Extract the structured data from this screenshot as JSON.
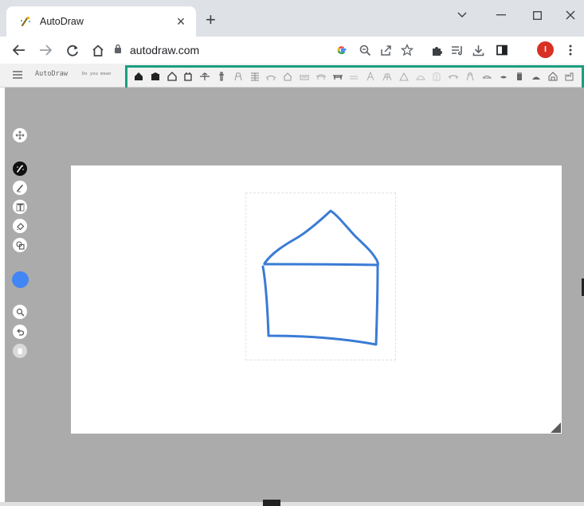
{
  "browser": {
    "tab_title": "AutoDraw",
    "new_tab_icon": "plus-icon",
    "url": "autodraw.com",
    "profile_initial": "I",
    "profile_color": "#d93025",
    "toolbar_icons": [
      "google-icon",
      "zoom-icon",
      "share-icon",
      "bookmark-star-icon",
      "extensions-icon",
      "reading-list-icon",
      "download-icon",
      "side-panel-icon"
    ]
  },
  "app": {
    "brand": "AutoDraw",
    "suggestion_prompt": "Do you mean",
    "suggestions_highlight_color": "#1a9e7f",
    "suggestions": [
      "house",
      "barn",
      "house",
      "church",
      "castle",
      "tent",
      "tower",
      "lighthouse",
      "mailbox",
      "building",
      "shop",
      "apartment",
      "bus-stop",
      "fence",
      "playground",
      "slide",
      "pyramid",
      "igloo",
      "windmill",
      "bridge",
      "gazebo",
      "greenhouse",
      "cottage",
      "hut",
      "school",
      "temple",
      "factory"
    ],
    "tools": [
      "move-icon",
      "autodraw-icon",
      "draw-icon",
      "type-icon",
      "fill-icon",
      "shape-icon",
      "zoom-icon",
      "undo-icon",
      "delete-icon"
    ],
    "color_swatch": "#4285f4",
    "stroke_color": "#3a7bd5"
  }
}
